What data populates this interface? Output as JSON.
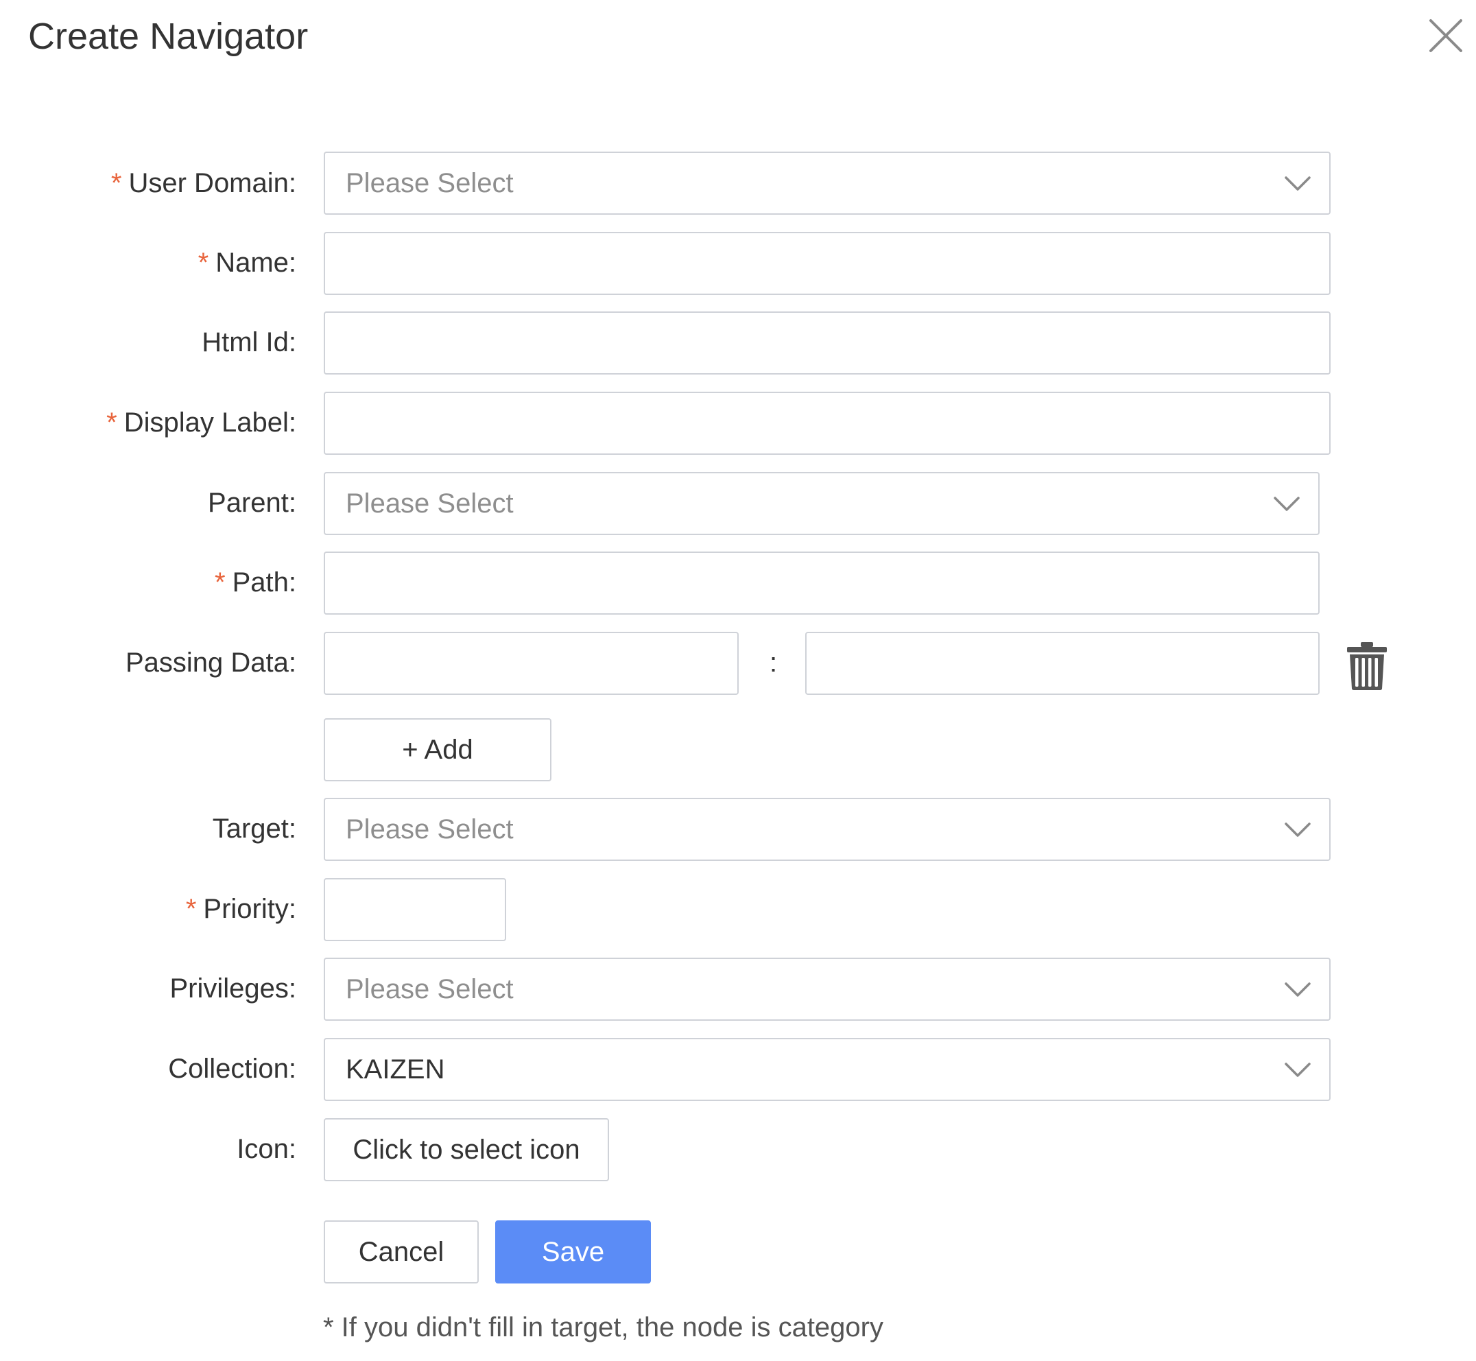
{
  "dialog": {
    "title": "Create Navigator"
  },
  "form": {
    "required_mark": "*",
    "user_domain": {
      "label": "User Domain:",
      "placeholder": "Please Select"
    },
    "name": {
      "label": "Name:",
      "value": ""
    },
    "html_id": {
      "label": "Html Id:",
      "value": ""
    },
    "display_label": {
      "label": "Display Label:",
      "value": ""
    },
    "parent": {
      "label": "Parent:",
      "placeholder": "Please Select"
    },
    "path": {
      "label": "Path:",
      "value": ""
    },
    "passing_data": {
      "label": "Passing Data:",
      "key": "",
      "value": "",
      "separator": ":"
    },
    "add_button": "+ Add",
    "target": {
      "label": "Target:",
      "placeholder": "Please Select"
    },
    "priority": {
      "label": "Priority:",
      "value": ""
    },
    "privileges": {
      "label": "Privileges:",
      "placeholder": "Please Select"
    },
    "collection": {
      "label": "Collection:",
      "value": "KAIZEN"
    },
    "icon": {
      "label": "Icon:",
      "button": "Click to select icon"
    }
  },
  "actions": {
    "cancel": "Cancel",
    "save": "Save"
  },
  "note": "* If you didn't fill in target, the node is category",
  "colors": {
    "primary": "#5b8cf6",
    "required": "#e8643c",
    "border": "#cfd2d8",
    "placeholder": "#8e8e8e"
  }
}
